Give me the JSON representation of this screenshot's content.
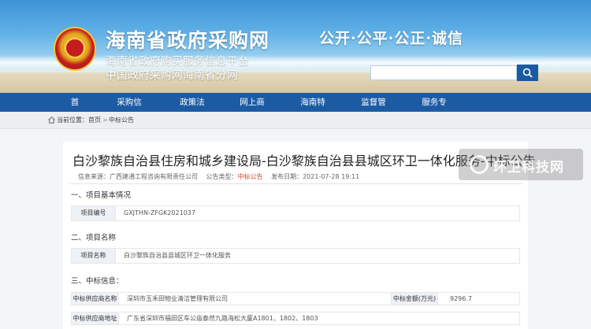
{
  "header": {
    "site_title": "海南省政府采购网",
    "subtitle_1": "海南省政府购买服务信息平台",
    "subtitle_2": "中国政府采购网海南省分网",
    "slogan": "公开·公平·公正·诚信",
    "search": {
      "value": "",
      "placeholder": ""
    }
  },
  "nav": {
    "items": [
      {
        "label": "首页"
      },
      {
        "label": "采购信息"
      },
      {
        "label": "政策法规"
      },
      {
        "label": "网上商城"
      },
      {
        "label": "海南特色"
      },
      {
        "label": "监督管理"
      },
      {
        "label": "服务专区"
      }
    ]
  },
  "breadcrumb": {
    "label": "当前位置：",
    "items": [
      "首页",
      "中标公告"
    ],
    "separator": ">"
  },
  "article": {
    "title": "白沙黎族自治县住房和城乡建设局-白沙黎族自治县县城区环卫一体化服务-中标公告",
    "meta": {
      "source_label": "信息来源：",
      "source_value": "广西建通工程咨询有限责任公司",
      "type_label": "公告类型：",
      "type_value": "中标公告",
      "date_label": "发布日期：",
      "date_value": "2021-07-28 19:11"
    },
    "sections": {
      "s1": {
        "title": "一、项目基本情况",
        "label": "项目编号",
        "value": "GXJTHN-ZFGK2021037"
      },
      "s2": {
        "title": "二、项目名称",
        "label": "项目名称",
        "value": "白沙黎族自治县县城区环卫一体化服务"
      },
      "s3": {
        "title": "三、中标信息：",
        "supplier_label": "中标供应商名称",
        "supplier_value": "深圳市玉禾田物业清洁管理有限公司",
        "amount_label": "中标金额(万元)",
        "amount_value": "9296.7",
        "address_label": "中标供应商地址",
        "address_value": "广东省深圳市福田区车公庙泰然九路海松大厦A1801、1802、1803"
      }
    }
  },
  "watermark": {
    "text": "环卫科技网"
  },
  "colors": {
    "nav": "#1c5ba4",
    "accent_red": "#d04a2c",
    "label_bg": "#eef1f5"
  }
}
